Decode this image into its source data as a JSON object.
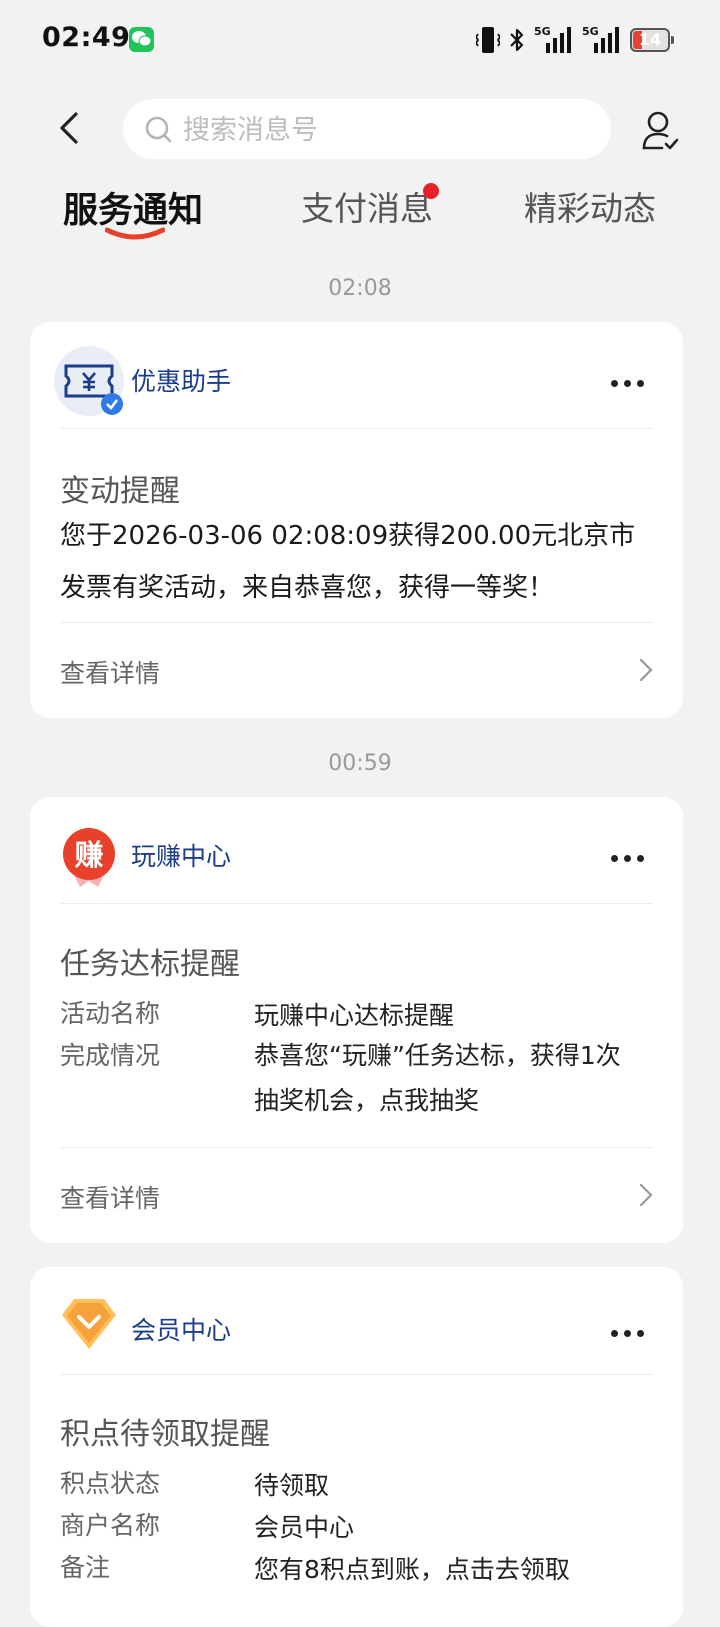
{
  "status_bar": {
    "time": "02:49",
    "battery": "14",
    "signal1": "5G",
    "signal2": "5G"
  },
  "search": {
    "placeholder": "搜索消息号"
  },
  "tabs": [
    {
      "label": "服务通知",
      "active": true
    },
    {
      "label": "支付消息",
      "badge": "unread-dot"
    },
    {
      "label": "精彩动态"
    }
  ],
  "messages": [
    {
      "time": "02:08",
      "sender": "优惠助手",
      "title": "变动提醒",
      "body": "您于2026-03-06 02:08:09获得200.00元北京市发票有奖活动，来自恭喜您，获得一等奖！",
      "detail": "查看详情"
    },
    {
      "time": "00:59",
      "sender": "玩赚中心",
      "avatar_text": "赚",
      "title": "任务达标提醒",
      "fields": [
        {
          "key": "活动名称",
          "value": "玩赚中心达标提醒"
        },
        {
          "key": "完成情况",
          "value": "恭喜您“玩赚”任务达标，获得1次抽奖机会，点我抽奖"
        }
      ],
      "detail": "查看详情"
    },
    {
      "sender": "会员中心",
      "title": "积点待领取提醒",
      "fields": [
        {
          "key": "积点状态",
          "value": "待领取"
        },
        {
          "key": "商户名称",
          "value": "会员中心"
        },
        {
          "key": "备注",
          "value": "您有8积点到账，点击去领取"
        }
      ]
    }
  ],
  "colors": {
    "accent": "#1a3c8a",
    "tab_underline": "#e8402a",
    "badge": "#e8202a",
    "wechat": "#20c45a"
  }
}
